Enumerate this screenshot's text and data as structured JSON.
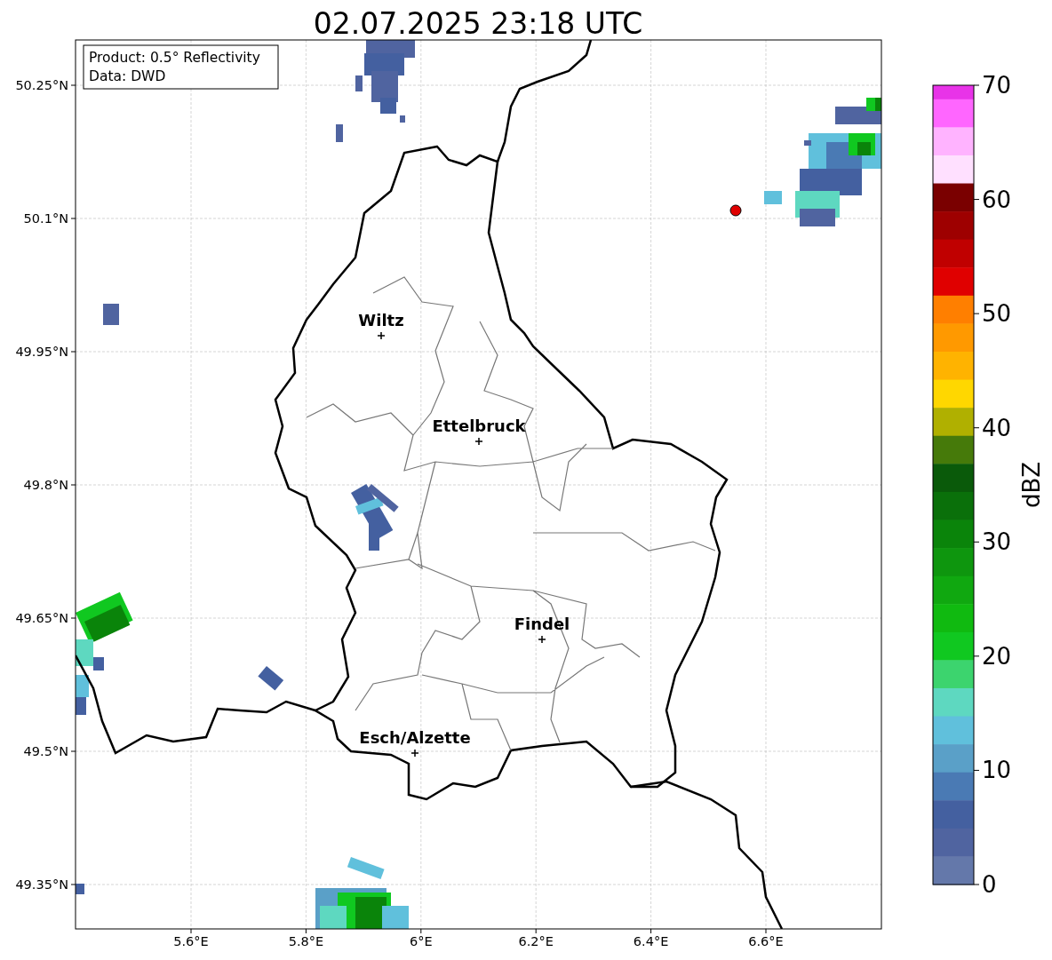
{
  "title": "02.07.2025 23:18 UTC",
  "info_box": [
    "Product: 0.5° Reflectivity",
    "Data: DWD"
  ],
  "y_ticks": [
    "50.25°N",
    "50.1°N",
    "49.95°N",
    "49.8°N",
    "49.65°N",
    "49.5°N",
    "49.35°N"
  ],
  "x_ticks": [
    "5.6°E",
    "5.8°E",
    "6°E",
    "6.2°E",
    "6.4°E",
    "6.6°E"
  ],
  "cities": [
    {
      "name": "Wiltz"
    },
    {
      "name": "Ettelbruck"
    },
    {
      "name": "Findel"
    },
    {
      "name": "Esch/Alzette"
    }
  ],
  "colorbar": {
    "label": "dBZ",
    "ticks": [
      "70",
      "60",
      "50",
      "40",
      "30",
      "20",
      "10",
      "0"
    ],
    "bins": [
      {
        "color": "#e833e8"
      },
      {
        "color": "#ff66ff"
      },
      {
        "color": "#ffb3ff"
      },
      {
        "color": "#ffe0ff"
      },
      {
        "color": "#7a0000"
      },
      {
        "color": "#9e0000"
      },
      {
        "color": "#c00000"
      },
      {
        "color": "#e00000"
      },
      {
        "color": "#ff7f00"
      },
      {
        "color": "#ff9900"
      },
      {
        "color": "#ffb300"
      },
      {
        "color": "#ffd700"
      },
      {
        "color": "#b0b000"
      },
      {
        "color": "#467a0a"
      },
      {
        "color": "#0a5a0a"
      },
      {
        "color": "#0a700a"
      },
      {
        "color": "#0a840a"
      },
      {
        "color": "#0e960e"
      },
      {
        "color": "#10a810"
      },
      {
        "color": "#10ba10"
      },
      {
        "color": "#10c820"
      },
      {
        "color": "#3cd46e"
      },
      {
        "color": "#5ed8c0"
      },
      {
        "color": "#60c0dc"
      },
      {
        "color": "#5aa0c8"
      },
      {
        "color": "#4a7ab4"
      },
      {
        "color": "#4460a0"
      },
      {
        "color": "#5064a0"
      },
      {
        "color": "#6478aa"
      }
    ]
  }
}
